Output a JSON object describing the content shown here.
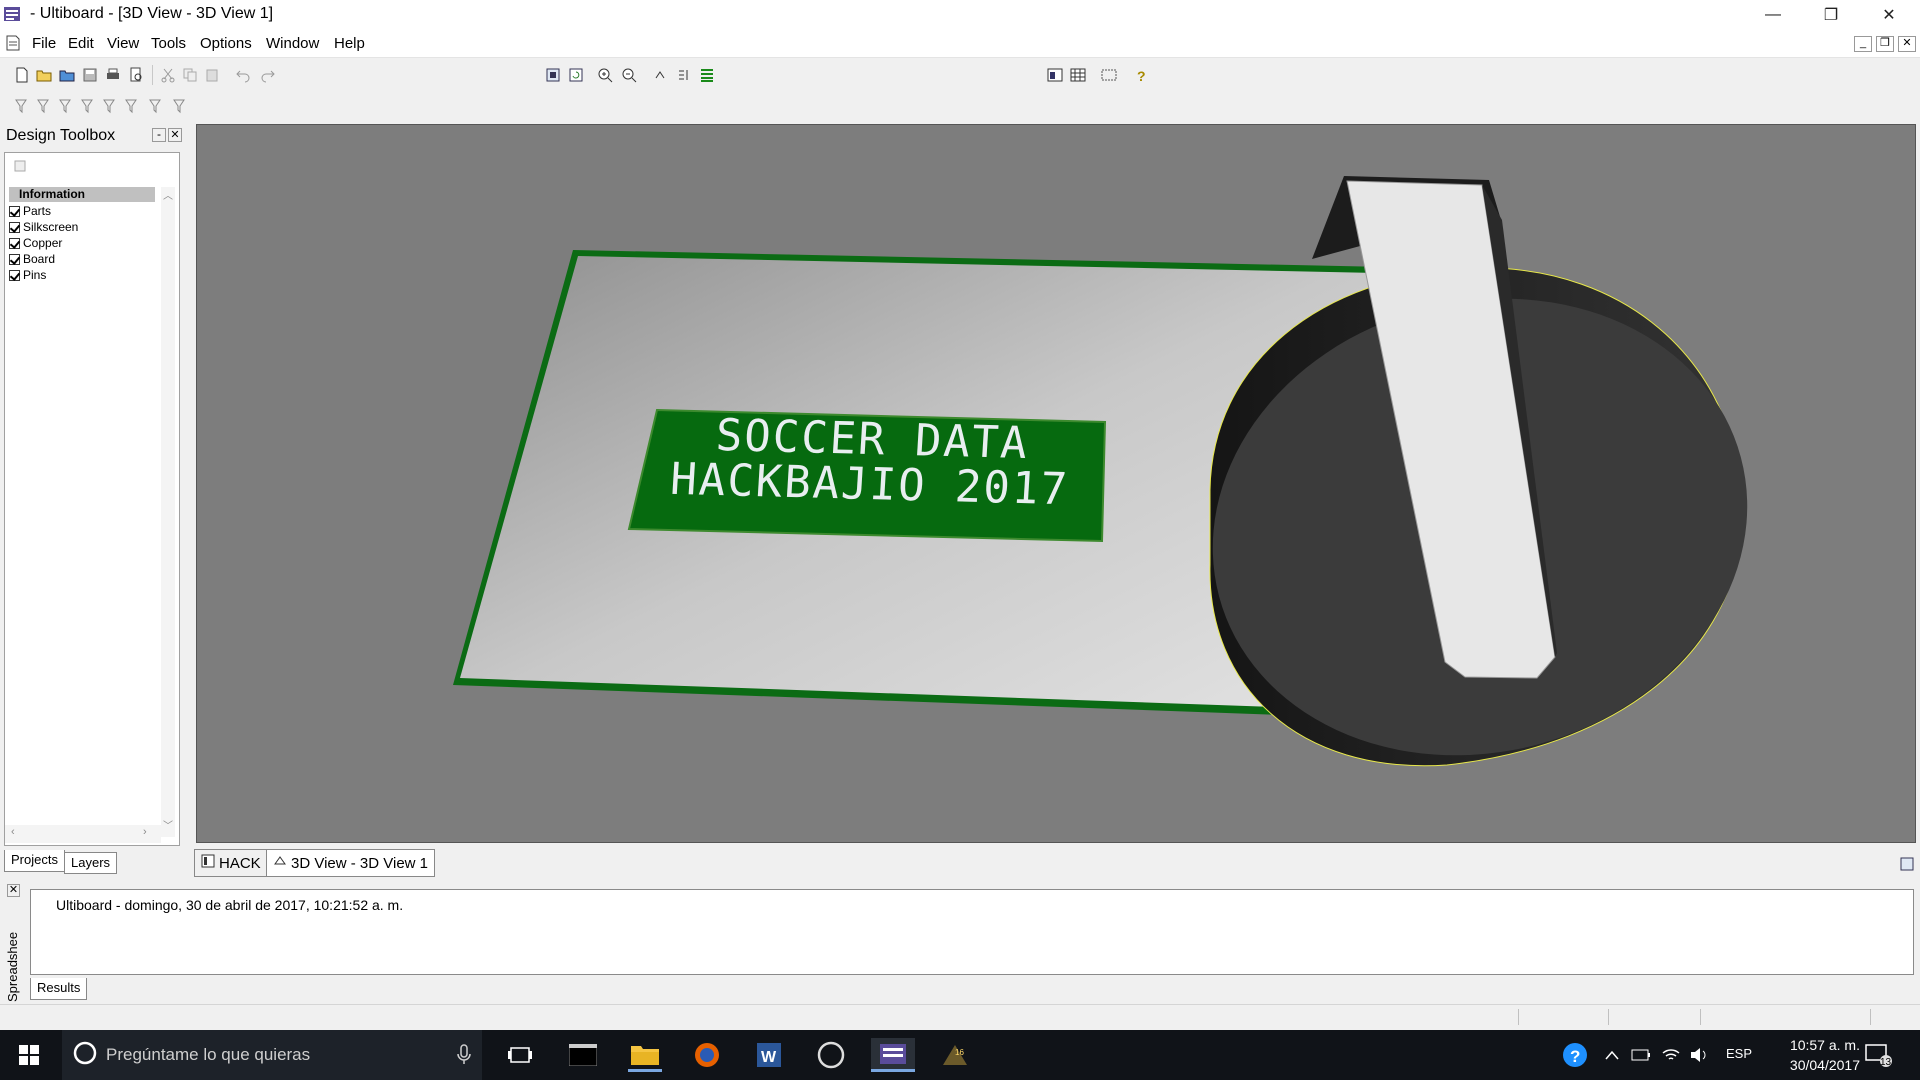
{
  "window": {
    "title": " - Ultiboard - [3D View - 3D View 1]",
    "minimize": "—",
    "restore": "❐",
    "close": "✕"
  },
  "menu": {
    "items": [
      {
        "label": "File"
      },
      {
        "label": "Edit"
      },
      {
        "label": "View"
      },
      {
        "label": "Tools"
      },
      {
        "label": "Options"
      },
      {
        "label": "Window"
      },
      {
        "label": "Help"
      }
    ],
    "mdi": [
      "_",
      "❐",
      "✕"
    ]
  },
  "toolbox": {
    "title": "Design Toolbox",
    "pin": "-",
    "close": "✕",
    "header": "Information",
    "items": [
      {
        "label": "Parts",
        "checked": true
      },
      {
        "label": "Silkscreen",
        "checked": true
      },
      {
        "label": "Copper",
        "checked": true
      },
      {
        "label": "Board",
        "checked": true
      },
      {
        "label": "Pins",
        "checked": true
      }
    ],
    "tabs": [
      "Projects",
      "Layers"
    ]
  },
  "board": {
    "line1": "SOCCER DATA",
    "line2": "HACKBAJIO 2017",
    "board_color": "#0b6b14",
    "label_color": "#066a0f",
    "knob_color": "#2b2b2b"
  },
  "doc_tabs": [
    {
      "label": "HACK",
      "active": false
    },
    {
      "label": "3D View - 3D View 1",
      "active": true
    }
  ],
  "output": {
    "side_label": "Spreadshee",
    "close": "✕",
    "line": "Ultiboard  -  domingo, 30 de abril de 2017, 10:21:52 a. m.",
    "tab": "Results"
  },
  "taskbar": {
    "search_placeholder": "Pregúntame lo que quieras",
    "language": "ESP",
    "time": "10:57 a. m.",
    "date": "30/04/2017",
    "notifications": "13"
  }
}
